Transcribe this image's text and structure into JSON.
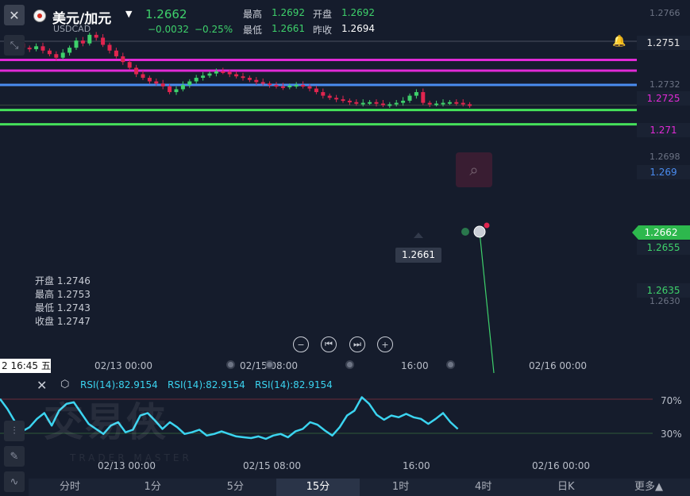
{
  "header": {
    "symbol_name": "美元/加元",
    "symbol_code": "USDCAD",
    "last_price": "1.2662",
    "change": "−0.0032",
    "change_pct": "−0.25%",
    "high_label": "最高",
    "high_value": "1.2692",
    "open_label": "开盘",
    "open_value": "1.2692",
    "low_label": "最低",
    "low_value": "1.2661",
    "prev_close_label": "昨收",
    "prev_close_value": "1.2694"
  },
  "price_axis": {
    "ticks": [
      "1.2766",
      "1.2732",
      "1.2698",
      "1.2630"
    ],
    "tags": [
      {
        "name": "alert-level",
        "value": "1.2751",
        "color": "#e8e8e8",
        "bg": "#1a2233"
      },
      {
        "name": "magenta-upper",
        "value": "1.2725",
        "color": "#e12ad6",
        "bg": "#1a2233"
      },
      {
        "name": "magenta-lower",
        "value": "1.271",
        "color": "#e12ad6",
        "bg": "#1a2233"
      },
      {
        "name": "blue-level",
        "value": "1.269",
        "color": "#4a8cf0",
        "bg": "#1a2233"
      },
      {
        "name": "current-price",
        "value": "1.2662",
        "color": "#ffffff",
        "bg": "#2db84d"
      },
      {
        "name": "green-upper",
        "value": "1.2655",
        "color": "#3ed16b",
        "bg": "#1a2233"
      },
      {
        "name": "green-lower",
        "value": "1.2635",
        "color": "#3ed16b",
        "bg": "#1a2233"
      }
    ]
  },
  "crosshair_price": "1.2661",
  "ohlc_panel": [
    {
      "label": "开盘",
      "value": "1.2746"
    },
    {
      "label": "最高",
      "value": "1.2753"
    },
    {
      "label": "最低",
      "value": "1.2743"
    },
    {
      "label": "收盘",
      "value": "1.2747"
    }
  ],
  "nav_buttons": [
    "zoom-out",
    "jump-start",
    "jump-end",
    "zoom-in"
  ],
  "cursor_time": "2 16:45 五",
  "time_axis": [
    "02/13 00:00",
    "02/15 08:00",
    "16:00",
    "02/16 00:00"
  ],
  "rsi": {
    "labels": [
      "RSI(14):82.9154",
      "RSI(14):82.9154",
      "RSI(14):82.9154"
    ],
    "level_high": "70%",
    "level_low": "30%"
  },
  "watermark": {
    "main": "交易侠",
    "sub": "TRADER MASTER"
  },
  "timeframes": [
    "分时",
    "1分",
    "5分",
    "15分",
    "1时",
    "4时",
    "日K",
    "更多▲"
  ],
  "active_timeframe": "15分",
  "colors": {
    "up": "#3ed16b",
    "down": "#e0254f",
    "background": "#151c2c",
    "rsi": "#3bd4f0"
  }
}
